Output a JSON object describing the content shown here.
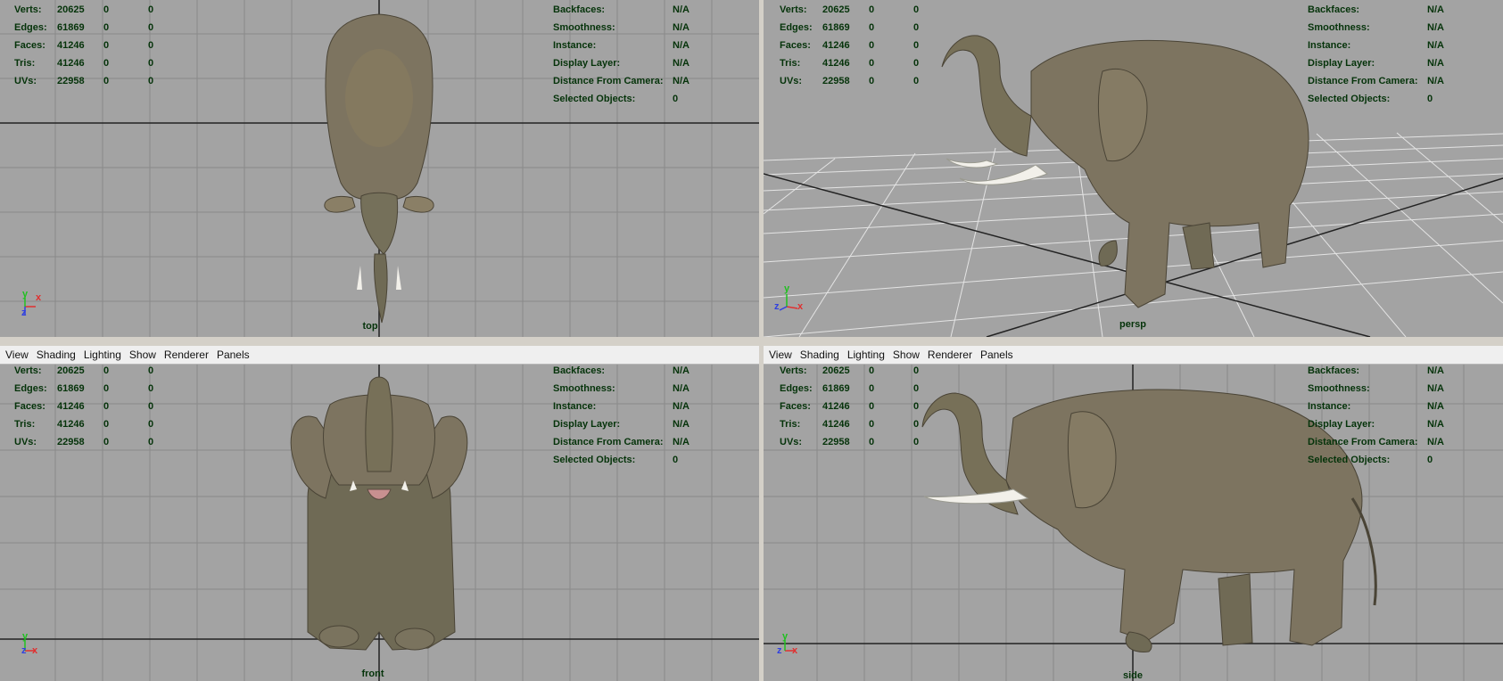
{
  "menu": [
    "View",
    "Shading",
    "Lighting",
    "Show",
    "Renderer",
    "Panels"
  ],
  "stats": {
    "left": [
      {
        "label": "Verts:",
        "v1": "20625",
        "v2": "0",
        "v3": "0"
      },
      {
        "label": "Edges:",
        "v1": "61869",
        "v2": "0",
        "v3": "0"
      },
      {
        "label": "Faces:",
        "v1": "41246",
        "v2": "0",
        "v3": "0"
      },
      {
        "label": "Tris:",
        "v1": "41246",
        "v2": "0",
        "v3": "0"
      },
      {
        "label": "UVs:",
        "v1": "22958",
        "v2": "0",
        "v3": "0"
      }
    ],
    "right": [
      {
        "label": "Backfaces:",
        "value": "N/A"
      },
      {
        "label": "Smoothness:",
        "value": "N/A"
      },
      {
        "label": "Instance:",
        "value": "N/A"
      },
      {
        "label": "Display Layer:",
        "value": "N/A"
      },
      {
        "label": "Distance From Camera:",
        "value": "N/A"
      },
      {
        "label": "Selected Objects:",
        "value": "0"
      }
    ]
  },
  "panels": {
    "top": {
      "camera": "top"
    },
    "persp": {
      "camera": "persp"
    },
    "front": {
      "camera": "front"
    },
    "side": {
      "camera": "side"
    }
  },
  "axes": {
    "x": "X",
    "y": "Y",
    "z": "Z"
  },
  "colors": {
    "viewport_bg": "#a3a3a3",
    "hud_text": "#05330a",
    "elephant_skin": "#7d7460",
    "tusk": "#f2f0ea",
    "axis_x": "#e03030",
    "axis_y": "#20c020",
    "axis_z": "#3040e0"
  }
}
